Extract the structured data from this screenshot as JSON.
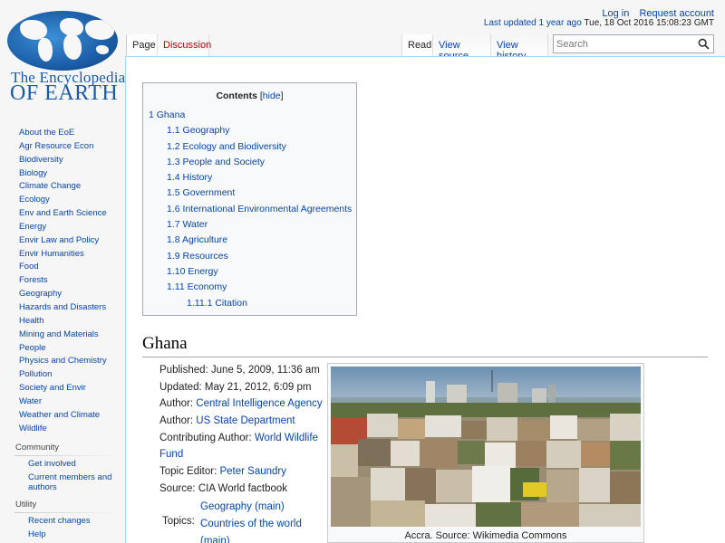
{
  "logo": {
    "line1": "The Encyclopedia",
    "line2": "OF EARTH"
  },
  "personal": {
    "login": "Log in",
    "request": "Request account"
  },
  "last_updated": {
    "link": "Last updated 1 year ago",
    "date": "Tue, 18 Oct 2016 15:08:23 GMT"
  },
  "tabs": {
    "page": "Page",
    "discussion": "Discussion",
    "read": "Read",
    "view_source": "View source",
    "view_history": "View history"
  },
  "search": {
    "placeholder": "Search"
  },
  "sidebar": {
    "items": [
      "About the EoE",
      "Agr Resource Econ",
      "Biodiversity",
      "Biology",
      "Climate Change",
      "Ecology",
      "Env and Earth Science",
      "Energy",
      "Envir Law and Policy",
      "Envir Humanities",
      "Food",
      "Forests",
      "Geography",
      "Hazards and Disasters",
      "Health",
      "Mining and Materials",
      "People",
      "Physics and Chemistry",
      "Pollution",
      "Society and Envir",
      "Water",
      "Weather and Climate",
      "Wildlife"
    ],
    "community": {
      "heading": "Community",
      "items": [
        "Get involved",
        "Current members and authors"
      ]
    },
    "utility": {
      "heading": "Utility",
      "items": [
        "Recent changes",
        "Help"
      ]
    }
  },
  "toc": {
    "title": "Contents",
    "hide": "hide",
    "items": [
      {
        "num": "1",
        "text": "Ghana",
        "level": 1
      },
      {
        "num": "1.1",
        "text": "Geography",
        "level": 2
      },
      {
        "num": "1.2",
        "text": "Ecology and Biodiversity",
        "level": 2
      },
      {
        "num": "1.3",
        "text": "People and Society",
        "level": 2
      },
      {
        "num": "1.4",
        "text": "History",
        "level": 2
      },
      {
        "num": "1.5",
        "text": "Government",
        "level": 2
      },
      {
        "num": "1.6",
        "text": "International Environmental Agreements",
        "level": 2
      },
      {
        "num": "1.7",
        "text": "Water",
        "level": 2
      },
      {
        "num": "1.8",
        "text": "Agriculture",
        "level": 2
      },
      {
        "num": "1.9",
        "text": "Resources",
        "level": 2
      },
      {
        "num": "1.10",
        "text": "Energy",
        "level": 2
      },
      {
        "num": "1.11",
        "text": "Economy",
        "level": 2
      },
      {
        "num": "1.11.1",
        "text": "Citation",
        "level": 3
      }
    ]
  },
  "heading": "Ghana",
  "meta": {
    "published": "Published: June 5, 2009, 11:36 am",
    "updated": "Updated: May 21, 2012, 6:09 pm",
    "author1_label": "Author: ",
    "author1": "Central Intelligence Agency",
    "author2_label": "Author: ",
    "author2": "US State Department",
    "contrib_label": "Contributing Author: ",
    "contrib_1": "World Wildlife",
    "contrib_2": "Fund",
    "editor_label": "Topic Editor: ",
    "editor": "Peter Saundry",
    "source": "Source: CIA World factbook",
    "topics_label": "Topics:",
    "topics": [
      "Geography (main)",
      "Countries of the world",
      "(main)"
    ]
  },
  "figure": {
    "caption": "Accra. Source: Wikimedia Commons"
  }
}
